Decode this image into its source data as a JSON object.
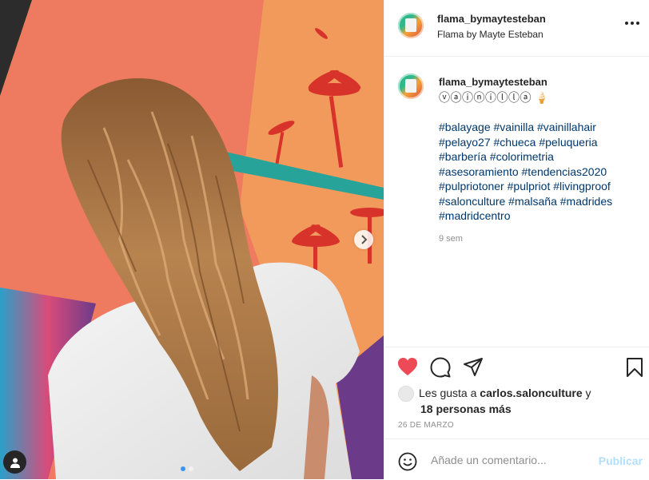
{
  "post": {
    "username": "flama_bymaytesteban",
    "display_name": "Flama by Mayte Esteban",
    "caption_text": "ⓥⓐⓘⓝⓘⓛⓛⓐ 🍦",
    "hashtags": [
      "#balayage",
      "#vainilla",
      "#vainillahair",
      "#pelayo27",
      "#chueca",
      "#peluqueria",
      "#barbería",
      "#colorimetria",
      "#asesoramiento",
      "#tendencias2020",
      "#pulpriotoner",
      "#pulpriot",
      "#livingproof",
      "#salonculture",
      "#malsaña",
      "#madrides",
      "#madridcentro"
    ],
    "caption_age": "9 sem",
    "likes_prefix": "Les gusta a ",
    "likes_user": "carlos.salonculture",
    "likes_suffix": " y",
    "likes_others": "18 personas más",
    "date": "26 DE MARZO",
    "comment_placeholder": "Añade un comentario...",
    "publish_label": "Publicar"
  },
  "colors": {
    "heart": "#ed4956",
    "link": "#00376b",
    "muted": "#8e8e8e",
    "publish_disabled": "#b2dffc"
  },
  "carousel": {
    "current": 1,
    "total": 2
  }
}
